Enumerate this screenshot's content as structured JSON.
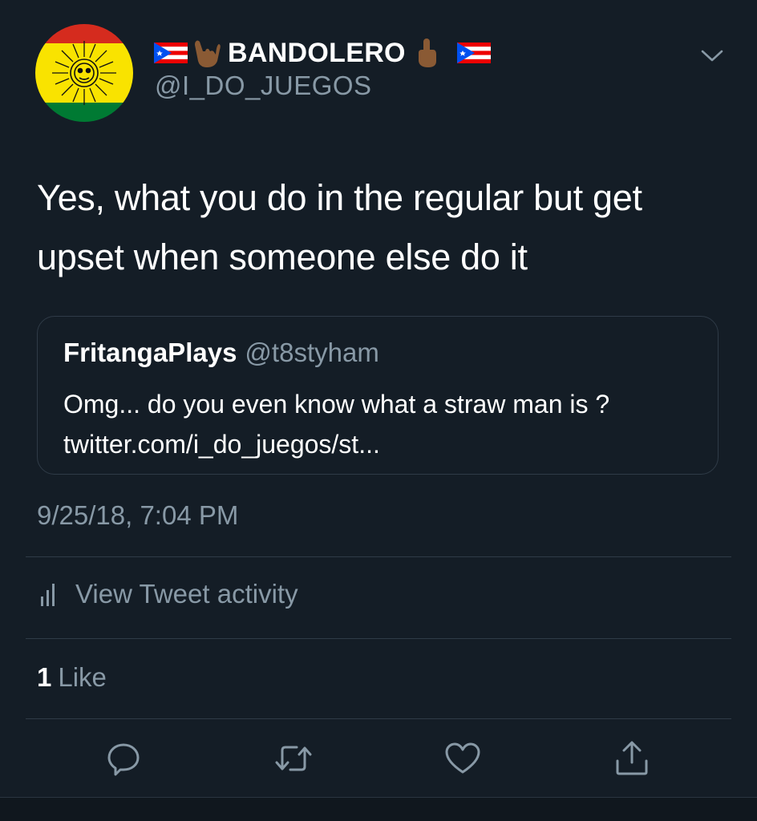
{
  "author": {
    "display_name": "BANDOLERO",
    "handle": "@I_DO_JUEGOS",
    "name_decorations": [
      "puerto-rico-flag-icon",
      "call-me-hand-icon",
      "pointing-up-icon",
      "puerto-rico-flag-icon"
    ]
  },
  "tweet": {
    "text": "Yes, what you do in the regular but get upset when someone else do it",
    "timestamp": "9/25/18, 7:04 PM"
  },
  "quoted_tweet": {
    "name": "FritangaPlays",
    "handle": "@t8styham",
    "text": "Omg... do you even know what a straw man is ? twitter.com/i_do_juegos/st..."
  },
  "activity": {
    "label": "View Tweet activity",
    "icon": "bar-chart-icon"
  },
  "likes": {
    "count": "1",
    "label": "Like"
  },
  "actions": [
    "reply-icon",
    "retweet-icon",
    "like-icon",
    "share-icon"
  ],
  "colors": {
    "background": "#141d26",
    "primary_text": "#ffffff",
    "secondary_text": "#8899a6",
    "border": "#2f3b47"
  }
}
